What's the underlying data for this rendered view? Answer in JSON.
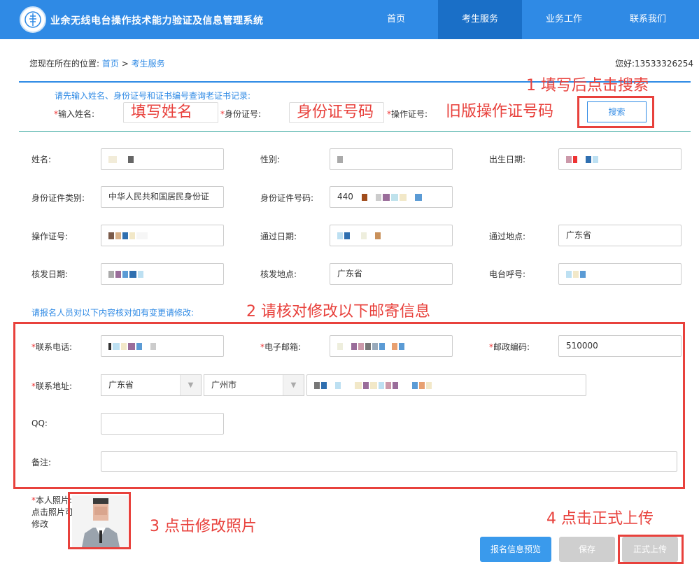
{
  "header": {
    "site_title": "业余无线电台操作技术能力验证及信息管理系统",
    "nav": [
      "首页",
      "考生服务",
      "业务工作",
      "联系我们"
    ]
  },
  "breadcrumb": {
    "prefix": "您现在所在的位置:",
    "home": "首页",
    "sep": ">",
    "current": "考生服务"
  },
  "user": {
    "greeting": "您好:",
    "phone": "13533326254"
  },
  "search": {
    "hint": "请先输入姓名、身份证号和证书编号查询老证书记录:",
    "name_label": "输入姓名:",
    "name_placeholder": "填写姓名",
    "id_label": "身份证号:",
    "id_placeholder": "身份证号码",
    "cert_label": "操作证号:",
    "cert_placeholder": "旧版操作证号码",
    "button": "搜索"
  },
  "info": {
    "name_label": "姓名:",
    "gender_label": "性别:",
    "birth_label": "出生日期:",
    "idtype_label": "身份证件类别:",
    "idtype_value": "中华人民共和国居民身份证",
    "idno_label": "身份证件号码:",
    "idno_prefix": "440",
    "cert_label": "操作证号:",
    "pass_date_label": "通过日期:",
    "pass_place_label": "通过地点:",
    "pass_place_value": "广东省",
    "issue_date_label": "核发日期:",
    "issue_place_label": "核发地点:",
    "issue_place_value": "广东省",
    "callsign_label": "电台呼号:"
  },
  "mail": {
    "hint": "请报名人员对以下内容核对如有变更请修改:",
    "phone_label": "联系电话:",
    "email_label": "电子邮箱:",
    "zip_label": "邮政编码:",
    "zip_value": "510000",
    "address_label": "联系地址:",
    "province": "广东省",
    "city": "广州市",
    "qq_label": "QQ:",
    "remark_label": "备注:"
  },
  "photo": {
    "label_line1": "本人照片:",
    "label_line2": "点击照片可",
    "label_line3": "修改"
  },
  "buttons": {
    "preview": "报名信息预览",
    "save": "保存",
    "submit": "正式上传"
  },
  "annotations": {
    "step1": "1 填写后点击搜索",
    "step2": "2 请核对修改以下邮寄信息",
    "step3": "3 点击修改照片",
    "step4": "4 点击正式上传"
  },
  "colors": {
    "primary": "#2f8ae5",
    "annotation": "#e8413c",
    "required": "#e33",
    "button_disabled": "#cfcfcf"
  }
}
